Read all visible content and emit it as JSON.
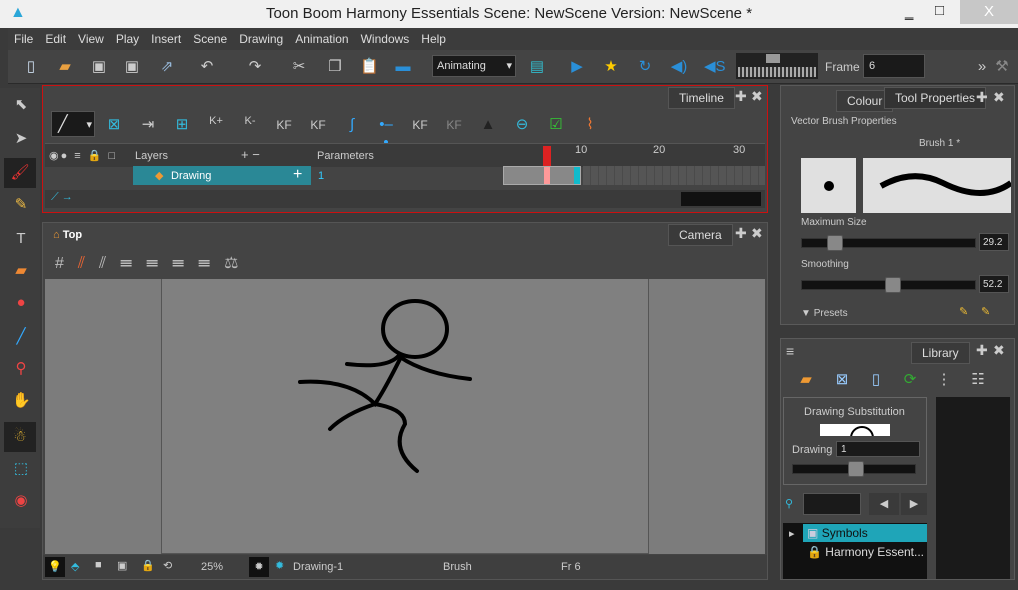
{
  "window": {
    "title": "Toon Boom Harmony Essentials Scene: NewScene Version: NewScene *",
    "minimize": "‗",
    "maximize": "□",
    "close": "X"
  },
  "menu": [
    "File",
    "Edit",
    "View",
    "Play",
    "Insert",
    "Scene",
    "Drawing",
    "Animation",
    "Windows",
    "Help"
  ],
  "toolbar": {
    "mode": "Animating",
    "frame_label": "Frame",
    "frame_value": "6"
  },
  "timeline": {
    "tab": "Timeline",
    "layers_header": "Layers",
    "parameters_header": "Parameters",
    "layer_name": "Drawing",
    "layer_param": "1",
    "ruler": [
      "10",
      "20",
      "30"
    ],
    "current_frame": 6,
    "tools": [
      "K+",
      "K-",
      "KF",
      "KF",
      "KF",
      "KF"
    ]
  },
  "camera": {
    "tab": "Camera",
    "view": "Top"
  },
  "status": {
    "zoom": "25%",
    "drawing": "Drawing-1",
    "tool": "Brush",
    "frame": "Fr 6"
  },
  "tool_properties": {
    "tab_colour": "Colour",
    "tab_tool": "Tool Properties",
    "section": "Vector Brush Properties",
    "brush": "Brush 1 *",
    "max_size_label": "Maximum Size",
    "max_size": "29.2",
    "smoothing_label": "Smoothing",
    "smoothing": "52.2",
    "presets": "Presets"
  },
  "library": {
    "tab": "Library",
    "substitution_title": "Drawing Substitution",
    "drawing_label": "Drawing",
    "drawing_value": "1",
    "tree": [
      "Symbols",
      "Harmony Essent..."
    ]
  },
  "colors": {
    "accent": "#2a9aac",
    "selection": "#1fa5b8",
    "red_border": "#cc1111",
    "bg": "#444444"
  }
}
